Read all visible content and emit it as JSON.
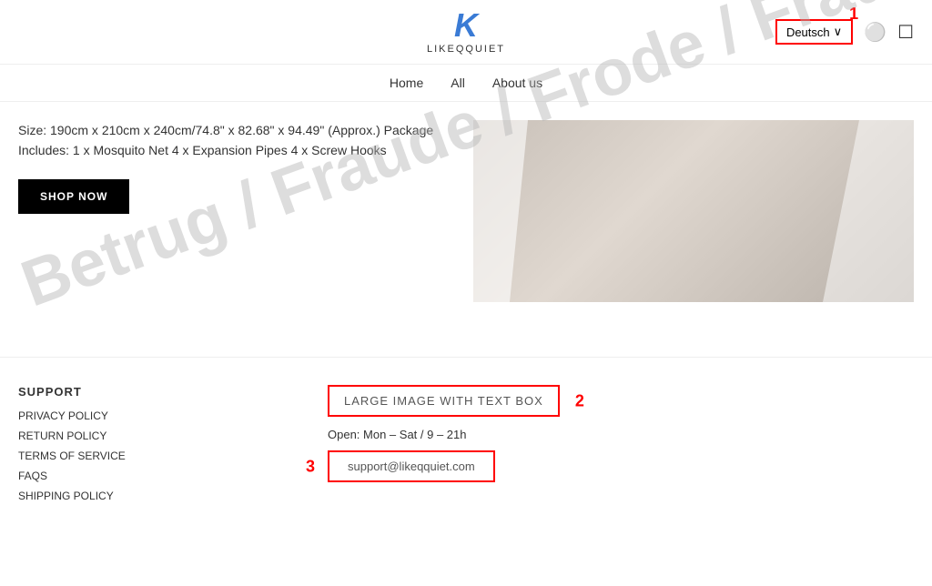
{
  "header": {
    "logo_k": "K",
    "logo_name": "LIKEQQUIET",
    "lang_button_label": "Deutsch",
    "lang_chevron": "∨",
    "label_1": "1"
  },
  "nav": {
    "items": [
      {
        "label": "Home",
        "href": "#"
      },
      {
        "label": "All",
        "href": "#"
      },
      {
        "label": "About us",
        "href": "#"
      }
    ]
  },
  "main": {
    "product_description": "Size: 190cm x 210cm x 240cm/74.8\" x 82.68\" x 94.49\" (Approx.) Package Includes: 1 x Mosquito Net 4 x Expansion Pipes 4 x Screw Hooks",
    "shop_now_label": "SHOP NOW"
  },
  "watermark": {
    "text": "Betrug / Fraude / Frode / Fraud"
  },
  "footer": {
    "support_title": "SUPPORT",
    "links": [
      {
        "label": "PRIVACY POLICY"
      },
      {
        "label": "RETURN POLICY"
      },
      {
        "label": "TERMS OF SERVICE"
      },
      {
        "label": "FAQS"
      },
      {
        "label": "SHIPPING POLICY"
      }
    ],
    "large_image_box_label": "LARGE IMAGE WITH TEXT BOX",
    "open_hours": "Open: Mon – Sat / 9 – 21h",
    "email": "support@likeqquiet.com",
    "label_2": "2",
    "label_3": "3"
  }
}
